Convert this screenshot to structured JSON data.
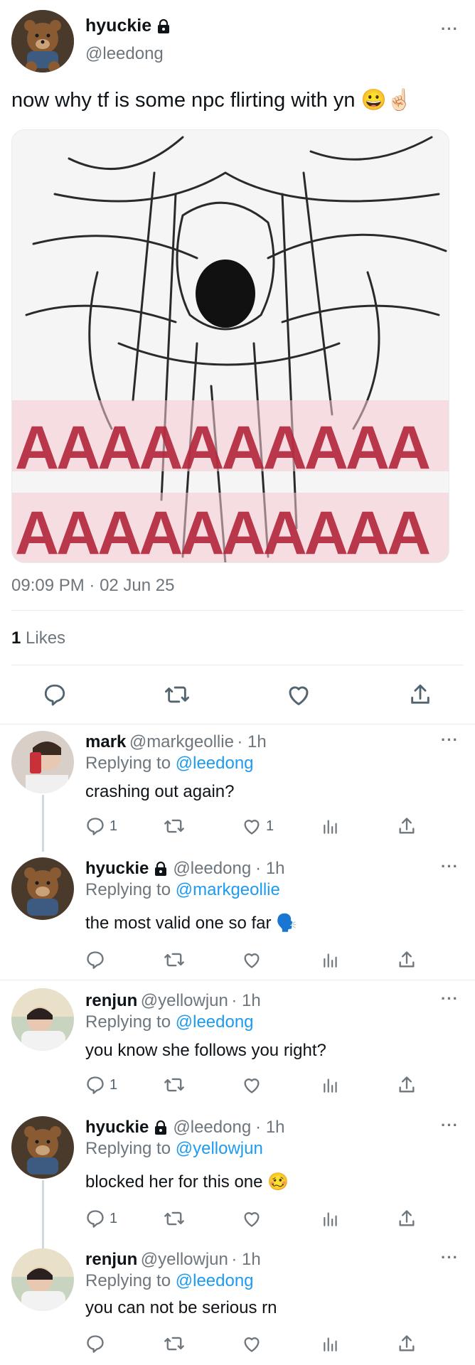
{
  "tweet": {
    "display_name": "hyuckie",
    "handle": "@leedong",
    "text": "now why tf is some npc flirting with yn 😀☝🏻",
    "image_caption_rows": [
      "AAAAAAAAAA",
      "AAAAAAAAAA"
    ],
    "time": "09:09 PM",
    "separator": " · ",
    "date": "02 Jun 25",
    "likes_count": "1",
    "likes_label": " Likes"
  },
  "replies": [
    {
      "name": "mark",
      "handle": "@markgeollie",
      "time": "· 1h",
      "replying_prefix": "Replying to ",
      "replying_to": "@leedong",
      "text": "crashing out again?",
      "reply_count": "1",
      "like_count": "1"
    },
    {
      "name": "hyuckie",
      "handle": "@leedong",
      "time": "· 1h",
      "replying_prefix": "Replying to ",
      "replying_to": "@markgeollie",
      "text": "the most valid one so far 🗣️",
      "reply_count": "",
      "like_count": ""
    },
    {
      "name": "renjun",
      "handle": "@yellowjun",
      "time": "· 1h",
      "replying_prefix": "Replying to ",
      "replying_to": "@leedong",
      "text": "you know she follows you right?",
      "reply_count": "1",
      "like_count": ""
    },
    {
      "name": "hyuckie",
      "handle": "@leedong",
      "time": "· 1h",
      "replying_prefix": "Replying to ",
      "replying_to": "@yellowjun",
      "text": "blocked her for this one 🥴",
      "reply_count": "1",
      "like_count": ""
    },
    {
      "name": "renjun",
      "handle": "@yellowjun",
      "time": "· 1h",
      "replying_prefix": "Replying to ",
      "replying_to": "@leedong",
      "text": "you can not be serious rn",
      "reply_count": "",
      "like_count": ""
    }
  ],
  "icons": {
    "more": "more-icon",
    "lock": "lock-icon",
    "reply": "reply-icon",
    "retweet": "retweet-icon",
    "like": "like-icon",
    "views": "views-icon",
    "share": "share-icon"
  },
  "colors": {
    "link": "#1d9bf0",
    "muted": "#6e767d",
    "text": "#0f1419",
    "divider": "#e6ecf0",
    "image_text": "#b3263a"
  }
}
